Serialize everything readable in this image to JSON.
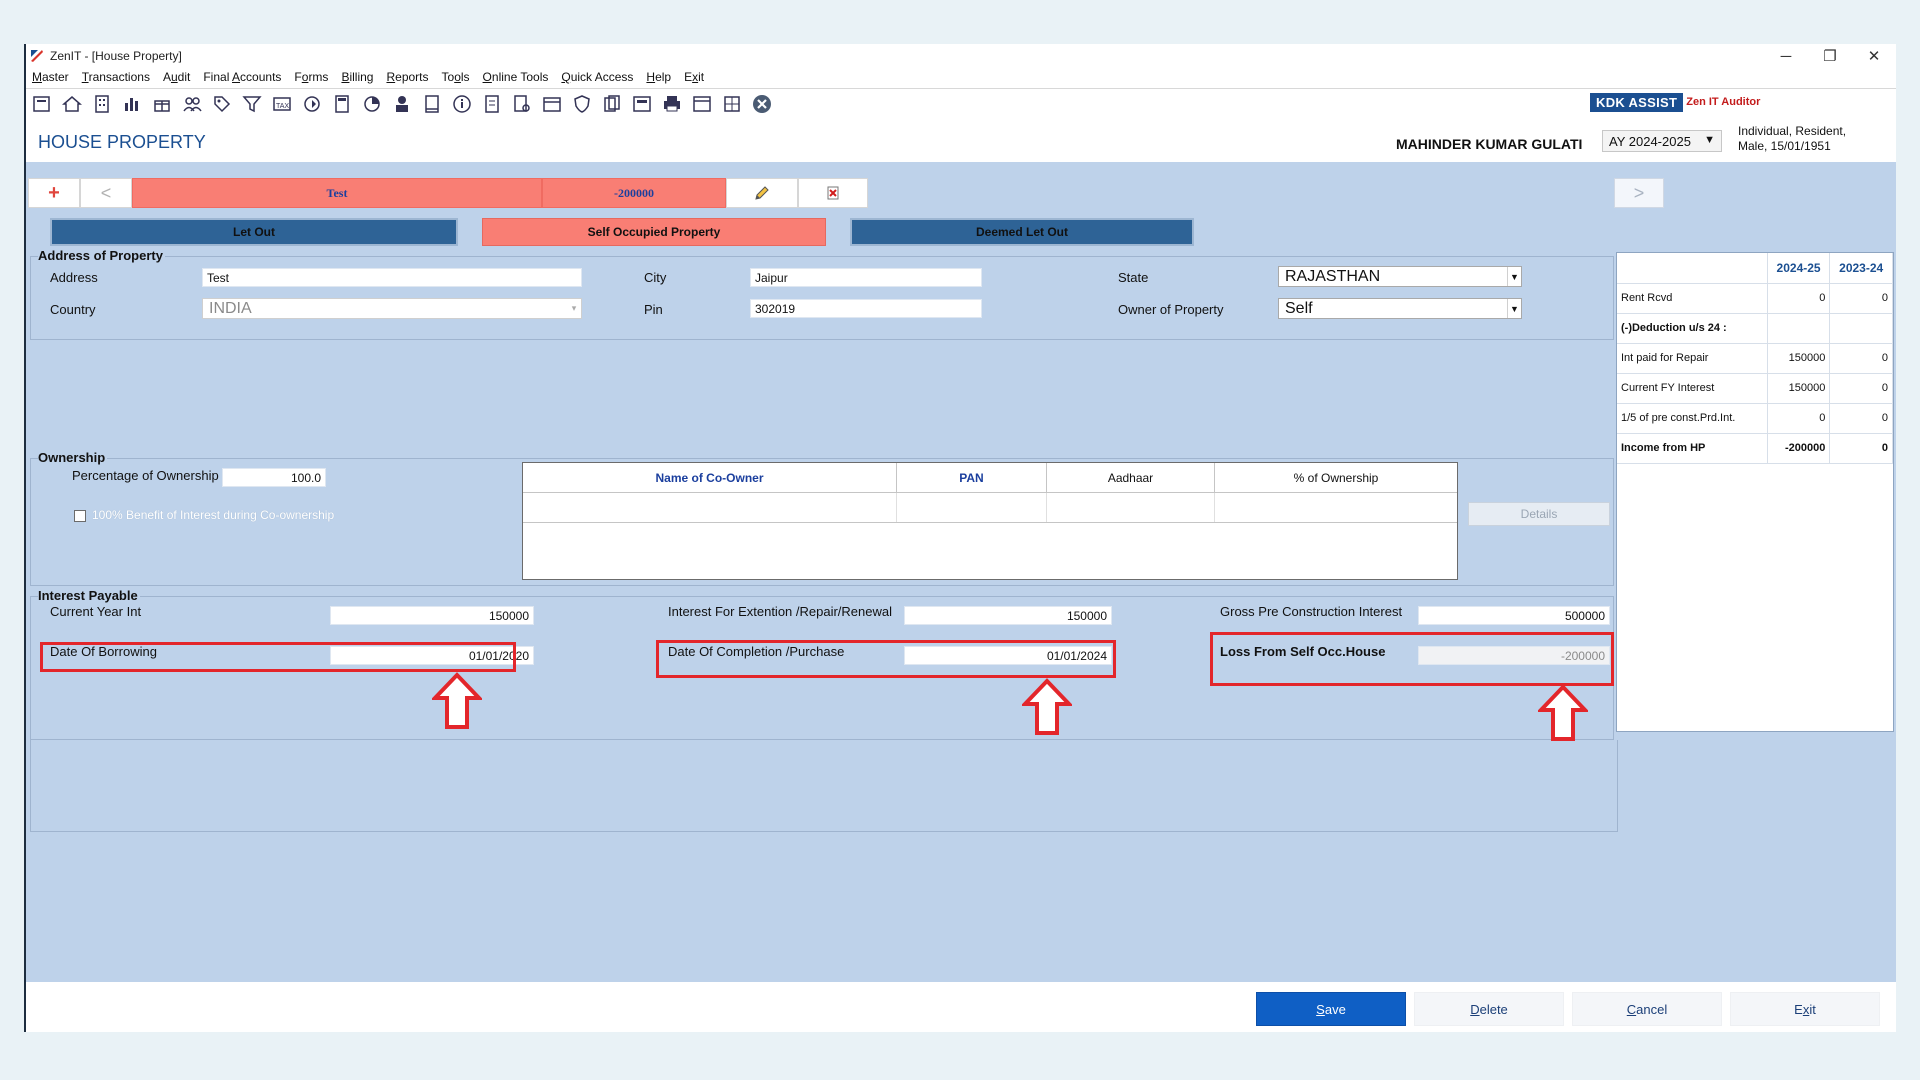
{
  "window": {
    "title": "ZenIT - [House Property]",
    "controls": {
      "minimize": "─",
      "restore": "❐",
      "close": "✕"
    }
  },
  "menu": [
    {
      "label": "Master",
      "u": "M",
      "rest": "aster"
    },
    {
      "label": "Transactions",
      "u": "T",
      "rest": "ransactions"
    },
    {
      "label": "Audit",
      "pre": "A",
      "u": "u",
      "rest": "dit"
    },
    {
      "label": "Final Accounts",
      "pre": "Final ",
      "u": "A",
      "rest": "ccounts"
    },
    {
      "label": "Forms",
      "pre": "F",
      "u": "o",
      "rest": "rms"
    },
    {
      "label": "Billing",
      "u": "B",
      "rest": "illing"
    },
    {
      "label": "Reports",
      "u": "R",
      "rest": "eports"
    },
    {
      "label": "Tools",
      "pre": "To",
      "u": "o",
      "rest": "ls"
    },
    {
      "label": "Online Tools",
      "u": "O",
      "rest": "nline Tools"
    },
    {
      "label": "Quick Access",
      "u": "Q",
      "rest": "uick Access"
    },
    {
      "label": "Help",
      "u": "H",
      "rest": "elp"
    },
    {
      "label": "Exit",
      "pre": "E",
      "u": "x",
      "rest": "it"
    }
  ],
  "branding": {
    "kdk": "KDK ASSIST",
    "zen": "Zen IT Auditor"
  },
  "header": {
    "page_title": "HOUSE PROPERTY",
    "client_name": "MAHINDER KUMAR GULATI",
    "ay": "AY 2024-2025",
    "client_info_line1": "Individual, Resident,",
    "client_info_line2": "Male, 15/01/1951"
  },
  "property_tabs": {
    "add": "+",
    "prev": "<",
    "name": "Test",
    "amount": "-200000",
    "next": ">"
  },
  "property_types": {
    "let_out": "Let Out",
    "self_occupied": "Self Occupied Property",
    "deemed_let_out": "Deemed Let Out"
  },
  "address": {
    "section_title": "Address of Property",
    "address_label": "Address",
    "address_value": "Test",
    "city_label": "City",
    "city_value": "Jaipur",
    "state_label": "State",
    "state_value": "RAJASTHAN",
    "country_label": "Country",
    "country_value": "INDIA",
    "pin_label": "Pin",
    "pin_value": "302019",
    "owner_label": "Owner of Property",
    "owner_value": "Self"
  },
  "ownership": {
    "section_title": "Ownership",
    "percentage_label": "Percentage of Ownership",
    "percentage_value": "100.0",
    "benefit_label": "100% Benefit of Interest during Co-ownership",
    "coowner_columns": [
      "Name of Co-Owner",
      "PAN",
      "Aadhaar",
      "% of Ownership"
    ],
    "details_button": "Details"
  },
  "interest": {
    "section_title": "Interest Payable",
    "current_year_label": "Current Year Int",
    "current_year_value": "150000",
    "extension_label": "Interest For Extention /Repair/Renewal",
    "extension_value": "150000",
    "gross_pre_label": "Gross Pre Construction Interest",
    "gross_pre_value": "500000",
    "borrowing_label": "Date Of Borrowing",
    "borrowing_value": "01/01/2020",
    "completion_label": "Date Of Completion /Purchase",
    "completion_value": "01/01/2024",
    "loss_label": "Loss From Self Occ.House",
    "loss_value": "-200000"
  },
  "summary": {
    "col1": "2024-25",
    "col2": "2023-24",
    "rows": [
      {
        "label": "Rent Rcvd",
        "v1": "0",
        "v2": "0",
        "bold": false
      },
      {
        "label": "(-)Deduction u/s 24 :",
        "v1": "",
        "v2": "",
        "bold": true
      },
      {
        "label": "Int paid for Repair",
        "v1": "150000",
        "v2": "0",
        "bold": false
      },
      {
        "label": "Current FY Interest",
        "v1": "150000",
        "v2": "0",
        "bold": false
      },
      {
        "label": "1/5 of pre const.Prd.Int.",
        "v1": "0",
        "v2": "0",
        "bold": false
      },
      {
        "label": "Income from HP",
        "v1": "-200000",
        "v2": "0",
        "bold": true
      }
    ]
  },
  "buttons": {
    "save_u": "S",
    "save_rest": "ave",
    "delete_u": "D",
    "delete_rest": "elete",
    "cancel_u": "C",
    "cancel_rest": "ancel",
    "exit_pre": "E",
    "exit_u": "x",
    "exit_rest": "it"
  },
  "colors": {
    "accent_blue": "#1b4f91",
    "salmon": "#f97e74",
    "annotation_red": "#e3262b",
    "panel_bg": "#bed2ea"
  }
}
